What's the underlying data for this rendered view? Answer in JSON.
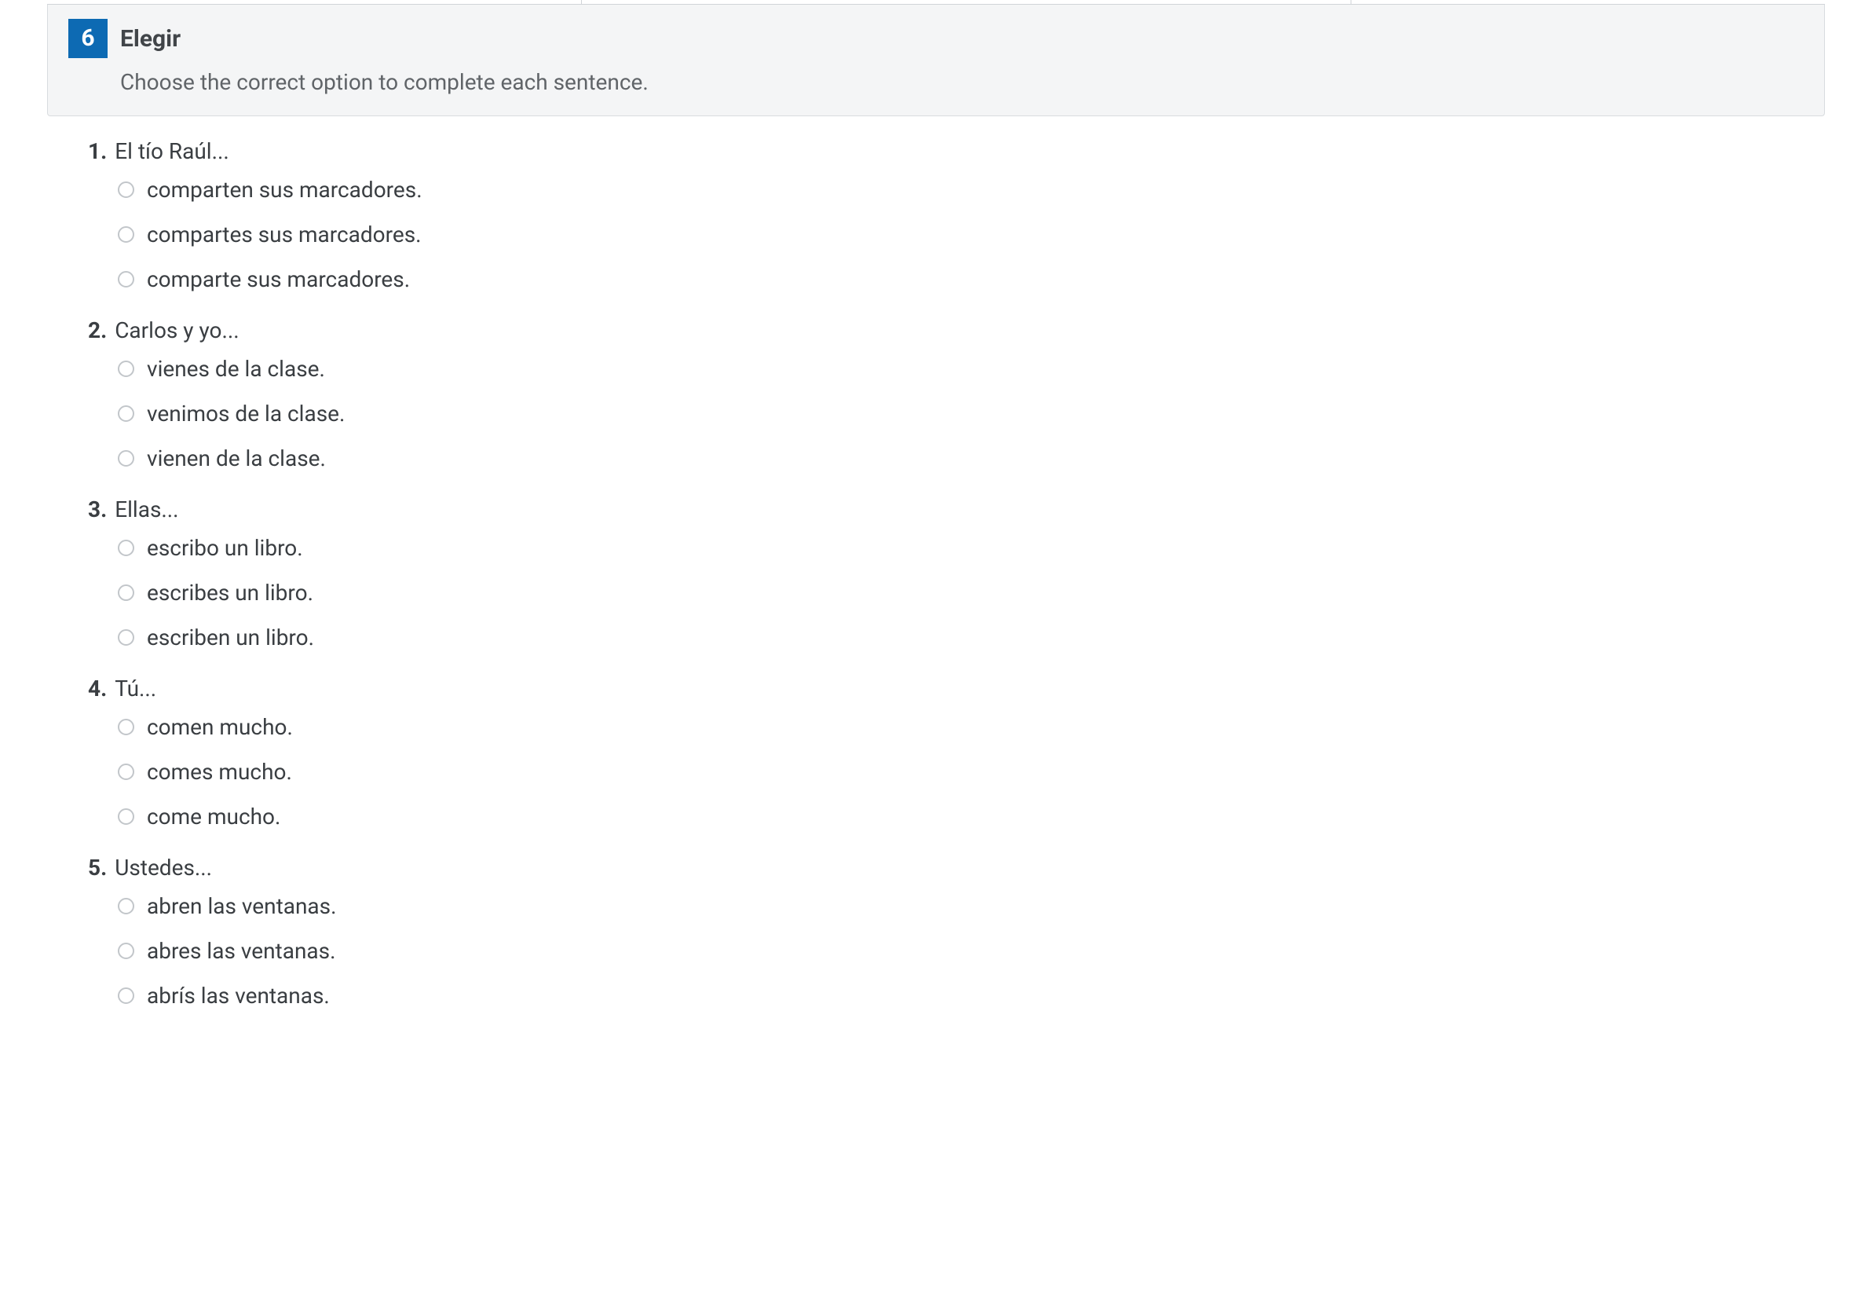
{
  "header": {
    "number": "6",
    "title": "Elegir",
    "instructions": "Choose the correct option to complete each sentence."
  },
  "questions": [
    {
      "num": "1.",
      "prompt": "El tío Raúl...",
      "options": [
        "comparten sus marcadores.",
        "compartes sus marcadores.",
        "comparte sus marcadores."
      ]
    },
    {
      "num": "2.",
      "prompt": "Carlos y yo...",
      "options": [
        "vienes de la clase.",
        "venimos de la clase.",
        "vienen de la clase."
      ]
    },
    {
      "num": "3.",
      "prompt": "Ellas...",
      "options": [
        "escribo un libro.",
        "escribes un libro.",
        "escriben un libro."
      ]
    },
    {
      "num": "4.",
      "prompt": "Tú...",
      "options": [
        "comen mucho.",
        "comes mucho.",
        "come mucho."
      ]
    },
    {
      "num": "5.",
      "prompt": "Ustedes...",
      "options": [
        "abren las ventanas.",
        "abres las ventanas.",
        "abrís las ventanas."
      ]
    }
  ]
}
